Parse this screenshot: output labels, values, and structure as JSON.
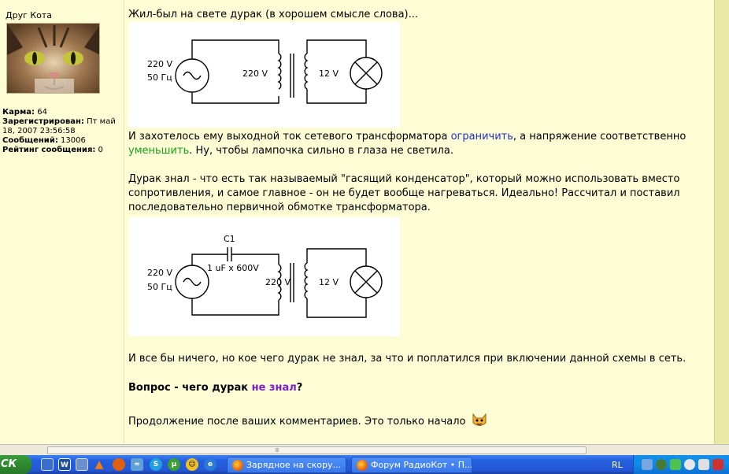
{
  "sidebar": {
    "author": "Друг Кота",
    "karma_label": "Карма:",
    "karma_value": "64",
    "registered_label": "Зарегистрирован:",
    "registered_value": "Пт май 18, 2007 23:56:58",
    "posts_label": "Сообщений:",
    "posts_value": "13006",
    "rating_label": "Рейтинг сообщения:",
    "rating_value": "0"
  },
  "post": {
    "intro": "Жил-был на свете дурак (в хорошем смысле слова)...",
    "para1_a": "И захотелось ему выходной ток сетевого трансформатора ",
    "para1_link1": "ограничить",
    "para1_b": ", а напряжение соответственно",
    "para1_link2": "уменьшить",
    "para1_c": ". Ну, чтобы лампочка сильно в глаза не светила.",
    "para2_line1": "Дурак знал - что есть так называемый \"гасящий конденсатор\", который можно использовать вместо",
    "para2_line2": "сопротивления, и самое главное - он не будет вообще нагреваться. Идеально! Рассчитал и поставил",
    "para2_line3": "последовательно первичной обмотке трансформатора.",
    "para3": "И все бы ничего, но кое чего дурак не знал, за что и поплатился при включении данной схемы в сеть.",
    "question_a": "Вопрос - чего дурак ",
    "question_link": "не знал",
    "question_b": "?",
    "outro": "Продолжение после ваших комментариев. Это только начало"
  },
  "diagram1": {
    "source_v": "220 V",
    "source_f": "50 Гц",
    "primary_v": "220 V",
    "secondary_v": "12 V"
  },
  "diagram2": {
    "cap_name": "C1",
    "cap_value": "1 uF x 600V",
    "source_v": "220 V",
    "source_f": "50 Гц",
    "primary_v": "220 V",
    "secondary_v": "12 V"
  },
  "taskbar": {
    "start_label": "СК",
    "task1": "Зарядное на скору...",
    "task2": "Форум РадиоКот • П...",
    "language": "RL"
  },
  "colors": {
    "background": "#fdfdd5",
    "link_blue": "#2030c8",
    "link_green": "#18a018",
    "link_purple": "#7a1ecf"
  }
}
